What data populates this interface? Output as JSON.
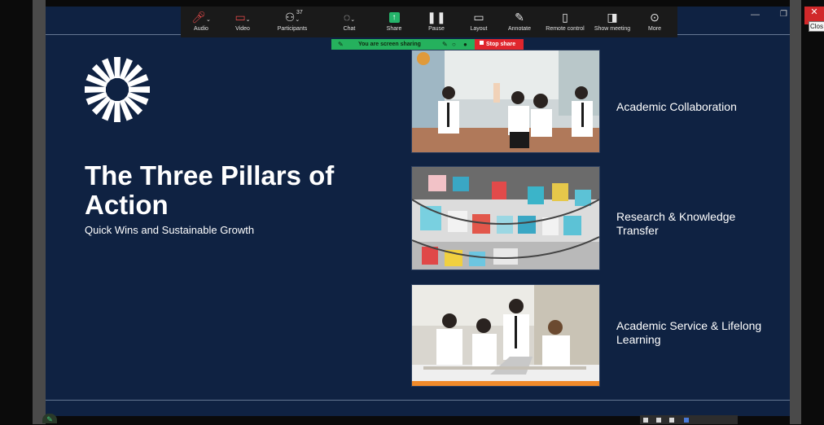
{
  "toolbar": {
    "audio": {
      "label": "Audio",
      "icon": "microphone-muted-icon"
    },
    "video": {
      "label": "Video",
      "icon": "camera-muted-icon"
    },
    "participants": {
      "label": "Participants",
      "count": "37",
      "icon": "participants-icon"
    },
    "chat": {
      "label": "Chat",
      "icon": "chat-icon"
    },
    "share": {
      "label": "Share",
      "icon": "share-icon"
    },
    "pause": {
      "label": "Pause",
      "icon": "pause-icon"
    },
    "layout": {
      "label": "Layout",
      "icon": "layout-icon"
    },
    "annotate": {
      "label": "Annotate",
      "icon": "pencil-icon"
    },
    "remote_control": {
      "label": "Remote control",
      "icon": "mouse-icon"
    },
    "show_meeting": {
      "label": "Show meeting",
      "icon": "window-icon"
    },
    "more": {
      "label": "More",
      "icon": "more-icon"
    }
  },
  "share_bar": {
    "status": "You are screen sharing",
    "stop_label": "Stop share",
    "bg_color": "#25b15d",
    "stop_color": "#e0262d"
  },
  "window": {
    "close_tooltip": "Clos"
  },
  "slide": {
    "title": "The Three Pillars of Action",
    "subtitle": "Quick Wins and Sustainable Growth",
    "background_color": "#0f2242",
    "pillars": [
      {
        "label": "Academic Collaboration"
      },
      {
        "label": "Research & Knowledge Transfer"
      },
      {
        "label": "Academic Service & Lifelong Learning"
      }
    ]
  }
}
